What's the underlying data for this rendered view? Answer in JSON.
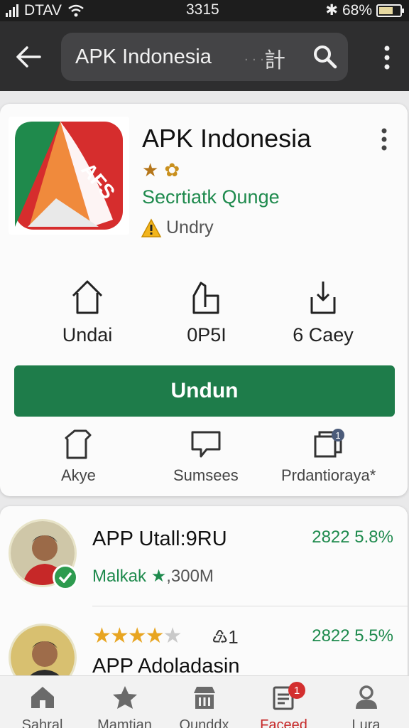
{
  "status_bar": {
    "carrier": "DTAV",
    "time": "3315",
    "battery": "68%",
    "battery_level": 0.68
  },
  "app_bar": {
    "search_value": "APK Indonesia",
    "search_glyph": "計",
    "icons": [
      "back-arrow-icon",
      "search-icon",
      "more-vert-icon"
    ]
  },
  "app": {
    "icon_text": "AFS",
    "title": "APK Indonesia",
    "publisher": "Secrtiatk Qunge",
    "warning": "Undry",
    "stats": [
      {
        "icon": "home-icon",
        "label": "Undai"
      },
      {
        "icon": "share-icon",
        "label": "0P5I"
      },
      {
        "icon": "download-icon",
        "label": "6 Caey"
      }
    ],
    "install_label": "Undun",
    "actions": [
      {
        "icon": "shirt-icon",
        "label": "Akye"
      },
      {
        "icon": "chat-icon",
        "label": "Sumsees"
      },
      {
        "icon": "gallery-icon",
        "label": "Prdantioraya*",
        "badge": "1"
      }
    ]
  },
  "list": [
    {
      "title": "APP Utall:9RU",
      "sub_label": "Malkak ★",
      "sub_value": ",300M",
      "meta": "2822 5.8%",
      "verified": true
    },
    {
      "title": "APP Adoladasin",
      "rating": 4.5,
      "rank": "♹1",
      "meta": "2822 5.5%"
    }
  ],
  "bottom_nav": [
    {
      "icon": "home-icon",
      "label": "Sahral"
    },
    {
      "icon": "star-icon",
      "label": "Mamtian"
    },
    {
      "icon": "store-icon",
      "label": "Ounddx"
    },
    {
      "icon": "document-icon",
      "label": "Faceed",
      "badge": "1",
      "active": true
    },
    {
      "icon": "person-icon",
      "label": "Lura"
    }
  ],
  "colors": {
    "accent_green": "#1e7c4a",
    "publisher_green": "#1e8a4d",
    "badge_red": "#d32f2f",
    "app_bar": "#2e2e2f"
  }
}
